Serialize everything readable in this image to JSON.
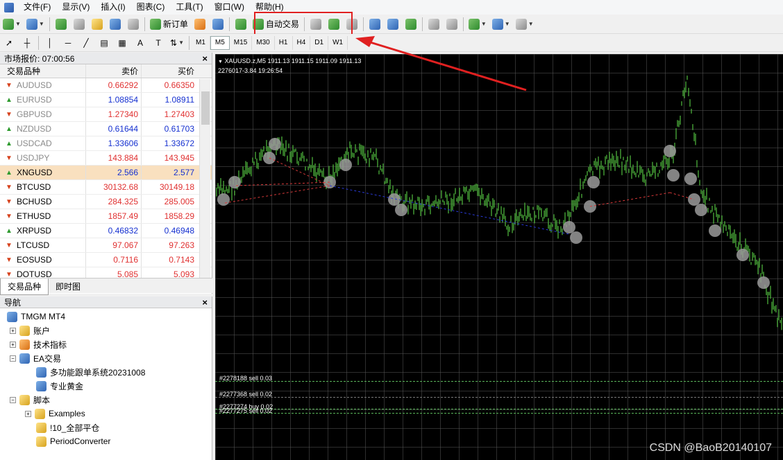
{
  "menu": [
    "文件(F)",
    "显示(V)",
    "插入(I)",
    "图表(C)",
    "工具(T)",
    "窗口(W)",
    "帮助(H)"
  ],
  "toolbar": {
    "new_order": "新订单",
    "auto_trade": "自动交易"
  },
  "periods": [
    "M1",
    "M5",
    "M15",
    "M30",
    "H1",
    "H4",
    "D1",
    "W1"
  ],
  "market": {
    "title": "市场报价: 07:00:56",
    "columns": [
      "交易品种",
      "卖价",
      "买价"
    ],
    "rows": [
      {
        "symbol": "AUDUSD",
        "bid": "0.66292",
        "ask": "0.66350",
        "dir": "down",
        "grey": true,
        "color": "red"
      },
      {
        "symbol": "EURUSD",
        "bid": "1.08854",
        "ask": "1.08911",
        "dir": "up",
        "grey": true,
        "color": "blue"
      },
      {
        "symbol": "GBPUSD",
        "bid": "1.27340",
        "ask": "1.27403",
        "dir": "down",
        "grey": true,
        "color": "red"
      },
      {
        "symbol": "NZDUSD",
        "bid": "0.61644",
        "ask": "0.61703",
        "dir": "up",
        "grey": true,
        "color": "blue"
      },
      {
        "symbol": "USDCAD",
        "bid": "1.33606",
        "ask": "1.33672",
        "dir": "up",
        "grey": true,
        "color": "blue"
      },
      {
        "symbol": "USDJPY",
        "bid": "143.884",
        "ask": "143.945",
        "dir": "down",
        "grey": true,
        "color": "red"
      },
      {
        "symbol": "XNGUSD",
        "bid": "2.566",
        "ask": "2.577",
        "dir": "up",
        "grey": false,
        "color": "blue",
        "selected": true
      },
      {
        "symbol": "BTCUSD",
        "bid": "30132.68",
        "ask": "30149.18",
        "dir": "down",
        "grey": false,
        "color": "red"
      },
      {
        "symbol": "BCHUSD",
        "bid": "284.325",
        "ask": "285.005",
        "dir": "down",
        "grey": false,
        "color": "red"
      },
      {
        "symbol": "ETHUSD",
        "bid": "1857.49",
        "ask": "1858.29",
        "dir": "down",
        "grey": false,
        "color": "red"
      },
      {
        "symbol": "XRPUSD",
        "bid": "0.46832",
        "ask": "0.46948",
        "dir": "up",
        "grey": false,
        "color": "blue"
      },
      {
        "symbol": "LTCUSD",
        "bid": "97.067",
        "ask": "97.263",
        "dir": "down",
        "grey": false,
        "color": "red"
      },
      {
        "symbol": "EOSUSD",
        "bid": "0.7116",
        "ask": "0.7143",
        "dir": "down",
        "grey": false,
        "color": "red"
      },
      {
        "symbol": "DOTUSD",
        "bid": "5.085",
        "ask": "5.093",
        "dir": "down",
        "grey": false,
        "color": "red"
      }
    ],
    "tabs": [
      "交易品种",
      "即时图"
    ]
  },
  "navigator": {
    "title": "导航",
    "root": "TMGM MT4",
    "accounts": "账户",
    "indicators": "技术指标",
    "ea": "EA交易",
    "ea_items": [
      "多功能跟单系统20231008",
      "专业黄金"
    ],
    "scripts": "脚本",
    "script_items": [
      "Examples",
      "!10_全部平仓",
      "PeriodConverter"
    ]
  },
  "chart": {
    "header_line1": "XAUUSD.z,M5  1911.13 1911.15 1911.09 1911.13",
    "header_line2": "2276017-3.84     19:26:54",
    "orders": [
      "#2278188 sell 0.03",
      "#2277368 sell 0.02",
      "#2277274 buy 0.02",
      "#2277275 sell 0.02"
    ]
  },
  "watermark": "CSDN @BaoB20140107",
  "colors": {
    "bid_red": "#e03030",
    "bid_blue": "#1530d0",
    "highlight": "#e02020",
    "candle": "#4caf3a"
  }
}
